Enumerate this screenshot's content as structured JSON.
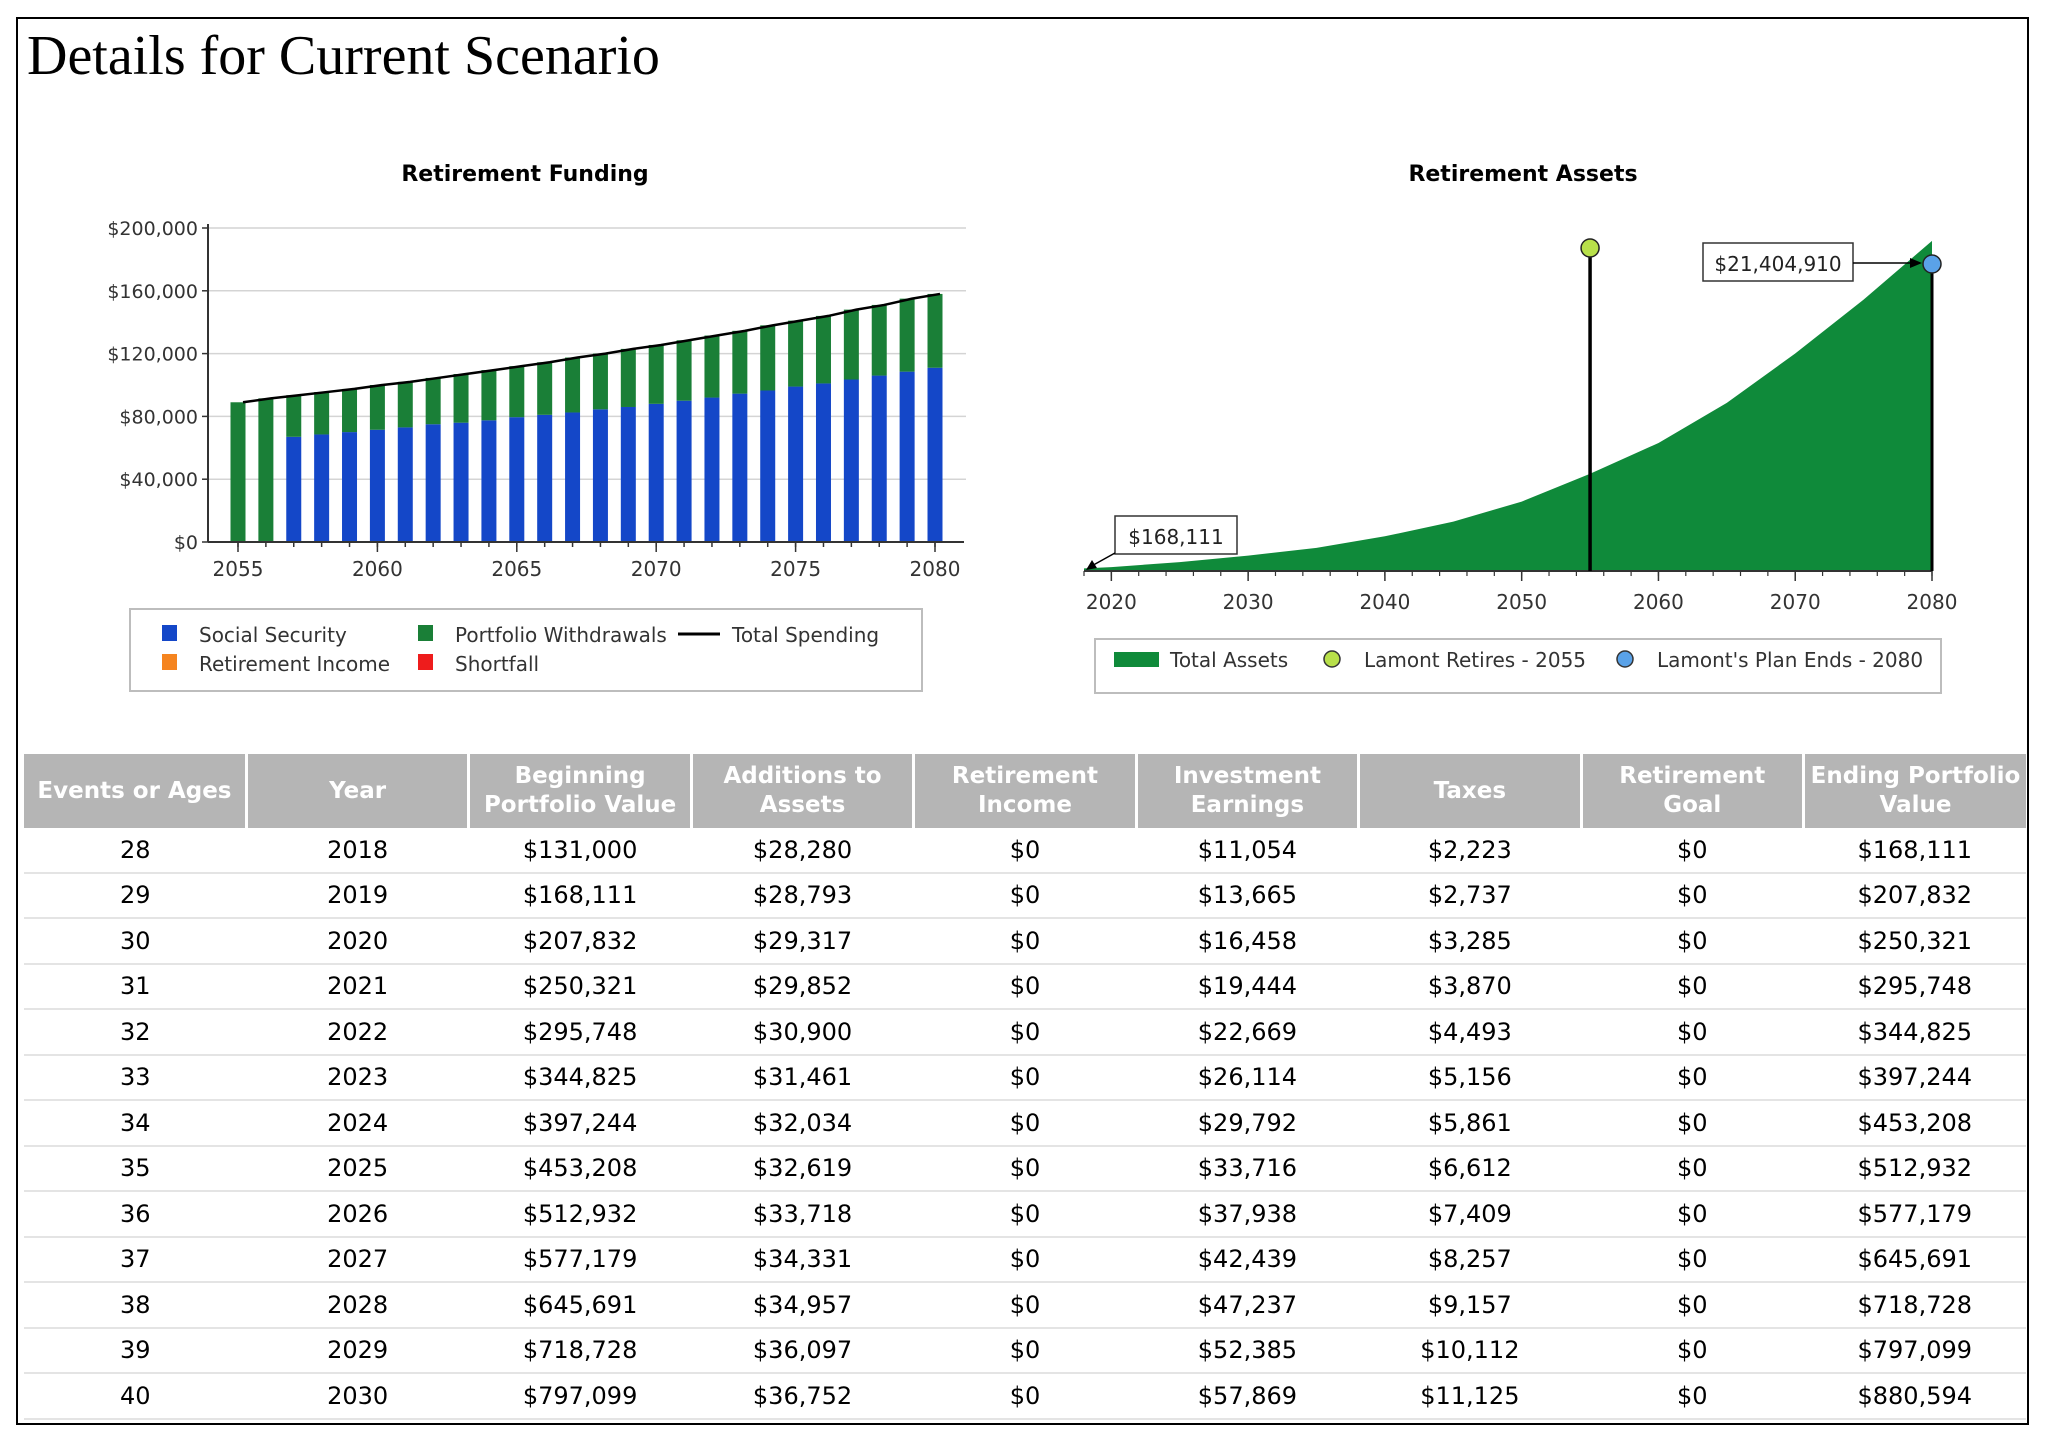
{
  "page": {
    "title": "Details for Current Scenario"
  },
  "colors": {
    "social_security": "#1447c8",
    "portfolio_withdrawals": "#1a7f37",
    "retirement_income": "#f5841f",
    "shortfall": "#ee1c1c",
    "total_spending": "#000000",
    "total_assets": "#0f8a3a",
    "retires_marker": "#b8e04a",
    "plan_ends_marker": "#5aa2e8",
    "table_header_bg": "#b5b5b5"
  },
  "chart_data": [
    {
      "id": "retirement-funding",
      "type": "bar",
      "stacked": true,
      "title": "Retirement Funding",
      "x": [
        2055,
        2056,
        2057,
        2058,
        2059,
        2060,
        2061,
        2062,
        2063,
        2064,
        2065,
        2066,
        2067,
        2068,
        2069,
        2070,
        2071,
        2072,
        2073,
        2074,
        2075,
        2076,
        2077,
        2078,
        2079,
        2080
      ],
      "x_ticks": [
        "2055",
        "2060",
        "2065",
        "2070",
        "2075",
        "2080"
      ],
      "y_ticks": [
        "$0",
        "$40,000",
        "$80,000",
        "$120,000",
        "$160,000",
        "$200,000"
      ],
      "ylim": [
        0,
        200000
      ],
      "grid": true,
      "series": [
        {
          "name": "Social Security",
          "values": [
            0,
            0,
            67000,
            68500,
            70000,
            71500,
            73000,
            75000,
            76000,
            77500,
            79500,
            81000,
            82500,
            84500,
            86000,
            88000,
            90000,
            92000,
            94500,
            96500,
            99000,
            101000,
            103500,
            106000,
            108500,
            111000
          ]
        },
        {
          "name": "Portfolio Withdrawals",
          "values": [
            89000,
            91500,
            26500,
            27000,
            27500,
            28500,
            29000,
            29500,
            31000,
            32000,
            32500,
            33500,
            35000,
            35500,
            37000,
            37500,
            38500,
            39500,
            40000,
            41500,
            42000,
            43000,
            44500,
            45000,
            46500,
            47000
          ]
        },
        {
          "name": "Retirement Income",
          "values": [
            0,
            0,
            0,
            0,
            0,
            0,
            0,
            0,
            0,
            0,
            0,
            0,
            0,
            0,
            0,
            0,
            0,
            0,
            0,
            0,
            0,
            0,
            0,
            0,
            0,
            0
          ]
        },
        {
          "name": "Shortfall",
          "values": [
            0,
            0,
            0,
            0,
            0,
            0,
            0,
            0,
            0,
            0,
            0,
            0,
            0,
            0,
            0,
            0,
            0,
            0,
            0,
            0,
            0,
            0,
            0,
            0,
            0,
            0
          ]
        }
      ],
      "line_series": {
        "name": "Total Spending",
        "values": [
          89000,
          91500,
          93500,
          95500,
          97500,
          100000,
          102000,
          104500,
          107000,
          109500,
          112000,
          114500,
          117500,
          120000,
          123000,
          125500,
          128500,
          131500,
          134500,
          138000,
          141000,
          144000,
          148000,
          151000,
          155000,
          158000
        ]
      },
      "legend": {
        "position": "bottom",
        "items": [
          {
            "label": "Social Security",
            "type": "box",
            "color": "#1447c8"
          },
          {
            "label": "Portfolio Withdrawals",
            "type": "box",
            "color": "#1a7f37"
          },
          {
            "label": "Total Spending",
            "type": "line",
            "color": "#000000"
          },
          {
            "label": "Retirement Income",
            "type": "box",
            "color": "#f5841f"
          },
          {
            "label": "Shortfall",
            "type": "box",
            "color": "#ee1c1c"
          }
        ]
      }
    },
    {
      "id": "retirement-assets",
      "type": "area",
      "title": "Retirement Assets",
      "x_range": [
        2018,
        2080
      ],
      "x_ticks": [
        "2020",
        "2030",
        "2040",
        "2050",
        "2060",
        "2070",
        "2080"
      ],
      "ylim": [
        0,
        26000000
      ],
      "grid": false,
      "series": [
        {
          "name": "Total Assets",
          "x": [
            2018,
            2020,
            2025,
            2030,
            2035,
            2040,
            2045,
            2050,
            2055,
            2060,
            2065,
            2070,
            2075,
            2080
          ],
          "values": [
            168111,
            250321,
            577179,
            1000000,
            1500000,
            2250000,
            3200000,
            4500000,
            6300000,
            8300000,
            10900000,
            14100000,
            17600000,
            21404910
          ]
        }
      ],
      "markers": [
        {
          "label": "Lamont Retires - 2055",
          "year": 2055,
          "color": "#b8e04a"
        },
        {
          "label": "Lamont's Plan Ends - 2080",
          "year": 2080,
          "color": "#5aa2e8"
        }
      ],
      "callouts": {
        "start": "$168,111",
        "end": "$21,404,910"
      },
      "legend": {
        "position": "bottom",
        "items": [
          {
            "label": "Total Assets",
            "type": "area",
            "color": "#0f8a3a"
          },
          {
            "label": "Lamont Retires - 2055",
            "type": "circle",
            "color": "#b8e04a"
          },
          {
            "label": "Lamont's Plan Ends - 2080",
            "type": "circle",
            "color": "#5aa2e8"
          }
        ]
      }
    }
  ],
  "table": {
    "columns": [
      "Events or Ages",
      "Year",
      "Beginning Portfolio Value",
      "Additions to Assets",
      "Retirement Income",
      "Investment Earnings",
      "Taxes",
      "Retirement Goal",
      "Ending Portfolio Value"
    ],
    "rows": [
      [
        "28",
        "2018",
        "$131,000",
        "$28,280",
        "$0",
        "$11,054",
        "$2,223",
        "$0",
        "$168,111"
      ],
      [
        "29",
        "2019",
        "$168,111",
        "$28,793",
        "$0",
        "$13,665",
        "$2,737",
        "$0",
        "$207,832"
      ],
      [
        "30",
        "2020",
        "$207,832",
        "$29,317",
        "$0",
        "$16,458",
        "$3,285",
        "$0",
        "$250,321"
      ],
      [
        "31",
        "2021",
        "$250,321",
        "$29,852",
        "$0",
        "$19,444",
        "$3,870",
        "$0",
        "$295,748"
      ],
      [
        "32",
        "2022",
        "$295,748",
        "$30,900",
        "$0",
        "$22,669",
        "$4,493",
        "$0",
        "$344,825"
      ],
      [
        "33",
        "2023",
        "$344,825",
        "$31,461",
        "$0",
        "$26,114",
        "$5,156",
        "$0",
        "$397,244"
      ],
      [
        "34",
        "2024",
        "$397,244",
        "$32,034",
        "$0",
        "$29,792",
        "$5,861",
        "$0",
        "$453,208"
      ],
      [
        "35",
        "2025",
        "$453,208",
        "$32,619",
        "$0",
        "$33,716",
        "$6,612",
        "$0",
        "$512,932"
      ],
      [
        "36",
        "2026",
        "$512,932",
        "$33,718",
        "$0",
        "$37,938",
        "$7,409",
        "$0",
        "$577,179"
      ],
      [
        "37",
        "2027",
        "$577,179",
        "$34,331",
        "$0",
        "$42,439",
        "$8,257",
        "$0",
        "$645,691"
      ],
      [
        "38",
        "2028",
        "$645,691",
        "$34,957",
        "$0",
        "$47,237",
        "$9,157",
        "$0",
        "$718,728"
      ],
      [
        "39",
        "2029",
        "$718,728",
        "$36,097",
        "$0",
        "$52,385",
        "$10,112",
        "$0",
        "$797,099"
      ],
      [
        "40",
        "2030",
        "$797,099",
        "$36,752",
        "$0",
        "$57,869",
        "$11,125",
        "$0",
        "$880,594"
      ]
    ]
  }
}
